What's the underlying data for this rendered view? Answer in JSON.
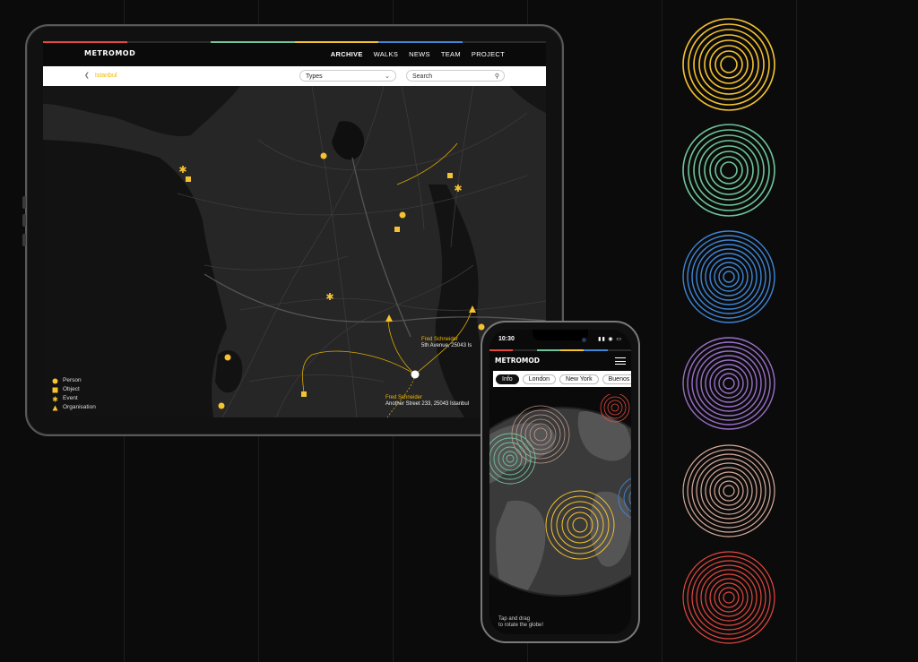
{
  "tablet": {
    "brand": "METROMOD",
    "nav": [
      {
        "label": "ARCHIVE",
        "active": true
      },
      {
        "label": "WALKS",
        "active": false
      },
      {
        "label": "NEWS",
        "active": false
      },
      {
        "label": "TEAM",
        "active": false
      },
      {
        "label": "PROJECT",
        "active": false
      }
    ],
    "breadcrumb": "Istanbul",
    "types_select": "Types",
    "search_placeholder": "Search",
    "legend": [
      {
        "label": "Person",
        "shape": "circle"
      },
      {
        "label": "Object",
        "shape": "square"
      },
      {
        "label": "Event",
        "shape": "star"
      },
      {
        "label": "Organisation",
        "shape": "triangle"
      }
    ],
    "popups": [
      {
        "name": "Fred Schneider",
        "address": "5th Avenue, 25043 Is"
      },
      {
        "name": "Fred Schneider",
        "address": "Another Street 233, 25043 Istanbul"
      }
    ]
  },
  "phone": {
    "time": "10:30",
    "brand": "METROMOD",
    "tabs": [
      {
        "label": "Info",
        "selected": true
      },
      {
        "label": "London",
        "selected": false
      },
      {
        "label": "New York",
        "selected": false
      },
      {
        "label": "Buenos",
        "selected": false
      }
    ],
    "hint_line1": "Tap and drag",
    "hint_line2": "to rotate the globe!"
  },
  "colors": {
    "accent": "#f0b800",
    "rings": [
      "#f5c230",
      "#6fc49a",
      "#3f86d6",
      "#9a6fc8",
      "#d6a99a",
      "#e3483e"
    ],
    "bar": [
      "#e3483e",
      "#3a3a3a",
      "#6fc49a",
      "#f5c230",
      "#3f86d6",
      "#3a3a3a"
    ]
  }
}
